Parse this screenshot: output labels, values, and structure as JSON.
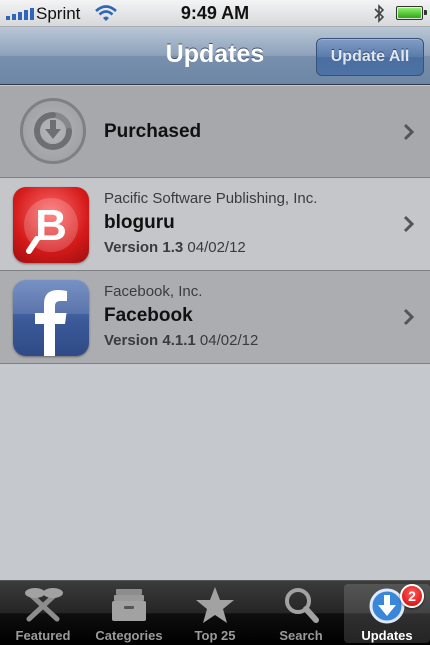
{
  "status_bar": {
    "carrier": "Sprint",
    "time": "9:49 AM",
    "icons": [
      "signal-icon",
      "wifi-icon",
      "bluetooth-icon",
      "battery-icon"
    ]
  },
  "nav": {
    "title": "Updates",
    "update_all_label": "Update All"
  },
  "purchased": {
    "label": "Purchased",
    "icon": "purchased-download-icon"
  },
  "apps": [
    {
      "vendor": "Pacific Software Publishing, Inc.",
      "name": "bloguru",
      "version_label": "Version 1.3",
      "date": "04/02/12",
      "icon": "bloguru-app-icon"
    },
    {
      "vendor": "Facebook, Inc.",
      "name": "Facebook",
      "version_label": "Version 4.1.1",
      "date": "04/02/12",
      "icon": "facebook-app-icon"
    }
  ],
  "tabs": [
    {
      "label": "Featured",
      "icon": "featured-icon",
      "active": false
    },
    {
      "label": "Categories",
      "icon": "categories-icon",
      "active": false
    },
    {
      "label": "Top 25",
      "icon": "star-icon",
      "active": false
    },
    {
      "label": "Search",
      "icon": "search-icon",
      "active": false
    },
    {
      "label": "Updates",
      "icon": "updates-icon",
      "active": true,
      "badge": "2"
    }
  ],
  "colors": {
    "nav_bar": "#7890ad",
    "tab_bar": "#0e0e0e",
    "badge": "#d10000"
  }
}
